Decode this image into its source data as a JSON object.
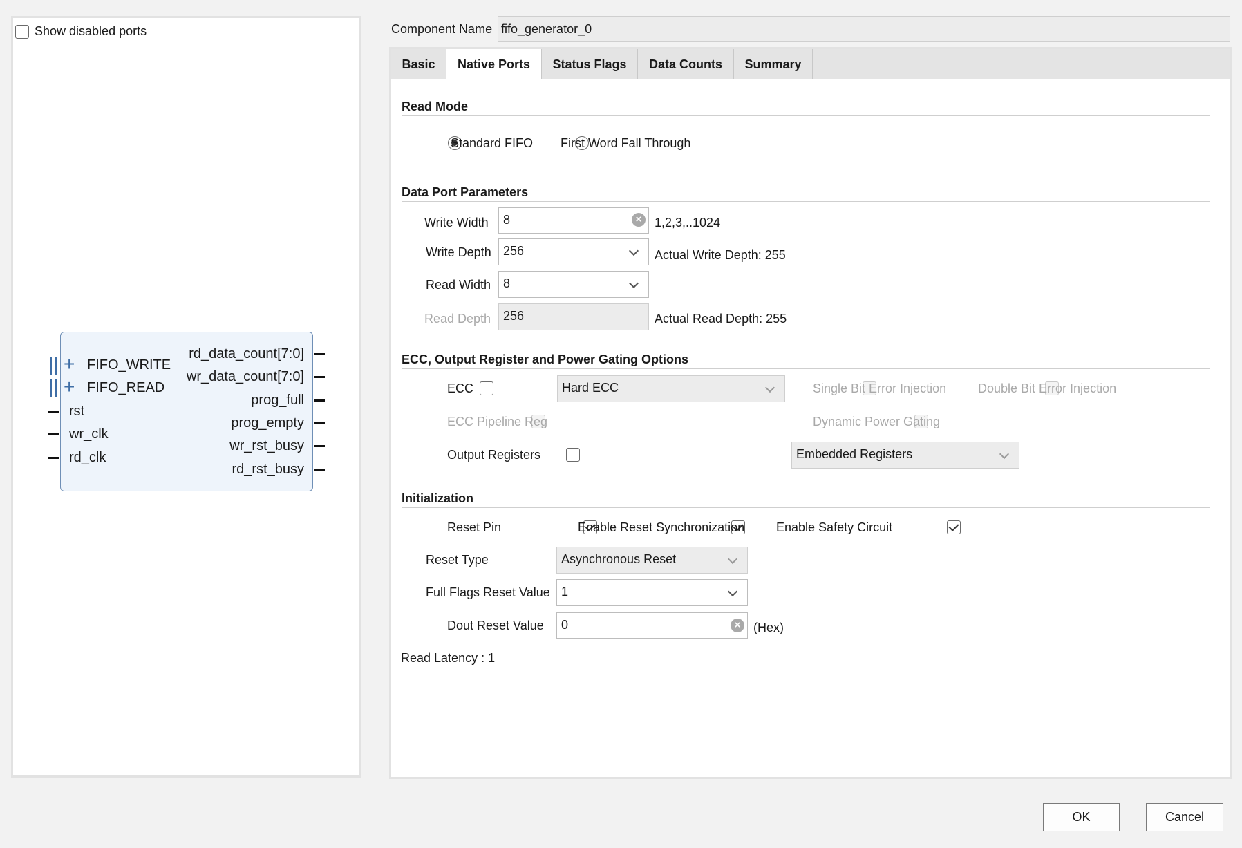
{
  "left_panel": {
    "show_disabled_ports": {
      "label": "Show disabled ports",
      "checked": false
    },
    "block": {
      "left_ports": [
        {
          "name": "FIFO_WRITE",
          "type": "bus"
        },
        {
          "name": "FIFO_READ",
          "type": "bus"
        },
        {
          "name": "rst",
          "type": "pin"
        },
        {
          "name": "wr_clk",
          "type": "pin"
        },
        {
          "name": "rd_clk",
          "type": "pin"
        }
      ],
      "right_ports": [
        "rd_data_count[7:0]",
        "wr_data_count[7:0]",
        "prog_full",
        "prog_empty",
        "wr_rst_busy",
        "rd_rst_busy"
      ]
    }
  },
  "component_name": {
    "label": "Component Name",
    "value": "fifo_generator_0"
  },
  "tabs": [
    {
      "label": "Basic",
      "active": false
    },
    {
      "label": "Native Ports",
      "active": true
    },
    {
      "label": "Status Flags",
      "active": false
    },
    {
      "label": "Data Counts",
      "active": false
    },
    {
      "label": "Summary",
      "active": false
    }
  ],
  "read_mode": {
    "title": "Read Mode",
    "options": [
      {
        "label": "Standard FIFO",
        "selected": true
      },
      {
        "label": "First Word Fall Through",
        "selected": false
      }
    ]
  },
  "data_port": {
    "title": "Data Port Parameters",
    "write_width": {
      "label": "Write Width",
      "value": "8",
      "hint": "1,2,3,..1024"
    },
    "write_depth": {
      "label": "Write Depth",
      "value": "256",
      "hint": "Actual Write Depth: 255"
    },
    "read_width": {
      "label": "Read Width",
      "value": "8"
    },
    "read_depth": {
      "label": "Read Depth",
      "value": "256",
      "hint": "Actual Read Depth: 255"
    }
  },
  "ecc_section": {
    "title": "ECC, Output Register and Power Gating Options",
    "ecc": {
      "label": "ECC",
      "checked": false
    },
    "ecc_type": {
      "value": "Hard ECC"
    },
    "single_bit": {
      "label": "Single Bit Error Injection",
      "checked": false
    },
    "double_bit": {
      "label": "Double Bit Error Injection",
      "checked": false
    },
    "ecc_pipeline": {
      "label": "ECC Pipeline Reg",
      "checked": false
    },
    "dynamic_power": {
      "label": "Dynamic Power Gating",
      "checked": false
    },
    "output_registers": {
      "label": "Output Registers",
      "checked": false
    },
    "output_reg_type": {
      "value": "Embedded Registers"
    }
  },
  "initialization": {
    "title": "Initialization",
    "reset_pin": {
      "label": "Reset Pin",
      "checked": true
    },
    "reset_sync": {
      "label": "Enable Reset Synchronization",
      "checked": true
    },
    "safety_circuit": {
      "label": "Enable Safety Circuit",
      "checked": true
    },
    "reset_type": {
      "label": "Reset Type",
      "value": "Asynchronous Reset"
    },
    "full_flags": {
      "label": "Full Flags Reset Value",
      "value": "1"
    },
    "dout_reset": {
      "label": "Dout Reset Value",
      "checked": true,
      "value": "0",
      "suffix": "(Hex)"
    }
  },
  "read_latency": "Read Latency : 1",
  "buttons": {
    "ok": "OK",
    "cancel": "Cancel"
  }
}
